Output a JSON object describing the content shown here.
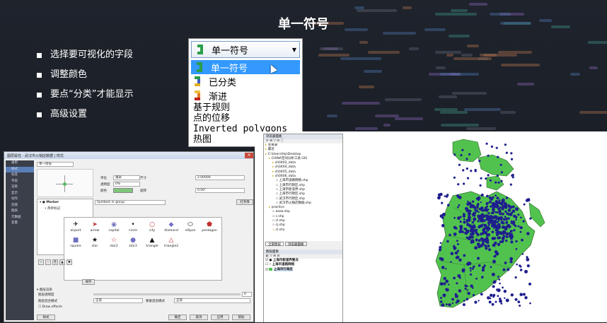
{
  "slide": {
    "title": "单一符号",
    "bullets": [
      "选择要可视化的字段",
      "调整颜色",
      "要点“分类”才能显示",
      "高级设置"
    ]
  },
  "renderer_dropdown": {
    "selected": "单一符号",
    "options_with_icons": [
      "单一符号",
      "已分类",
      "渐进"
    ],
    "options_plain": [
      "基于规则",
      "点的位移",
      "Inverted polygons",
      "热图"
    ],
    "colors": {
      "highlight": "#3399ff"
    }
  },
  "layer_properties": {
    "title": "图层属性 - 武汉市火锅店数据 | 样式",
    "sidebar": [
      "通用",
      "样式",
      "标签",
      "字段",
      "渲染",
      "显示",
      "动作",
      "连接",
      "图表",
      "元数据",
      "变量"
    ],
    "renderer": "单一符号",
    "unit_label": "单位",
    "unit_value": "毫米",
    "opacity_label": "透明度",
    "opacity_value": "0%",
    "color_label": "颜色",
    "size_label": "尺寸",
    "size_value": "2.00000",
    "rotation_label": "旋转",
    "rotation_value": "0.00°",
    "tree_root": "Marker",
    "tree_child": "简单标记",
    "symbols_in_group": "Symbols in group",
    "open_library": "打开库",
    "symbols": [
      {
        "glyph": "✈",
        "name": "airport"
      },
      {
        "glyph": "➤",
        "name": "arrow"
      },
      {
        "glyph": "◉",
        "name": "capital"
      },
      {
        "glyph": "•",
        "name": "circle"
      },
      {
        "glyph": "○",
        "name": "city"
      },
      {
        "glyph": "◆",
        "name": "diamond"
      },
      {
        "glyph": "⬭",
        "name": "ellipse"
      },
      {
        "glyph": "⬟",
        "name": "pentagon"
      },
      {
        "glyph": "■",
        "name": "square"
      },
      {
        "glyph": "★",
        "name": "star"
      },
      {
        "glyph": "☆",
        "name": "star2"
      },
      {
        "glyph": "●",
        "name": "star3"
      },
      {
        "glyph": "▲",
        "name": "triangle"
      },
      {
        "glyph": "△",
        "name": "triangle2"
      }
    ],
    "save_btn": "保存",
    "layer_render": "图层渲染",
    "layer_transparency": "图层透明度",
    "layer_blend": "图层混合模式",
    "feature_blend": "要素混合模式",
    "blend_value": "正常",
    "draw_effects": "Draw effects",
    "style_btn": "样式",
    "buttons": {
      "ok": "确定",
      "cancel": "取消",
      "apply": "应用",
      "help": "帮助"
    }
  },
  "qgis": {
    "browser_title": "浏览器面板",
    "browser_items": [
      "主目录",
      "最近",
      "C:\\Users\\Hp\\Desktop",
      "CHINA空间分析工具 GIS",
      "ch0402_data",
      "ch0404_data",
      "ch0405_data",
      "ch0406_data",
      "上海市道路网络.shp",
      "上海市行政区.shp",
      "上海市新道界.shp",
      "上海市行政区.shp",
      "武汉市行政区.shp",
      "武汉市火锅店数据.shp",
      "practice",
      "aaaa.shp",
      "c.shp",
      "cl.shp",
      "cj.shp",
      "cl.shx"
    ],
    "tab_all": "全部图层",
    "tab_browser": "浏览器面板",
    "layers_title": "图层面板",
    "layers": [
      "上海市新道界要点",
      "上海市道路网络",
      "上海市行政区"
    ],
    "colors": {
      "land": "#52c24f",
      "points": "#1f1f8e"
    }
  }
}
